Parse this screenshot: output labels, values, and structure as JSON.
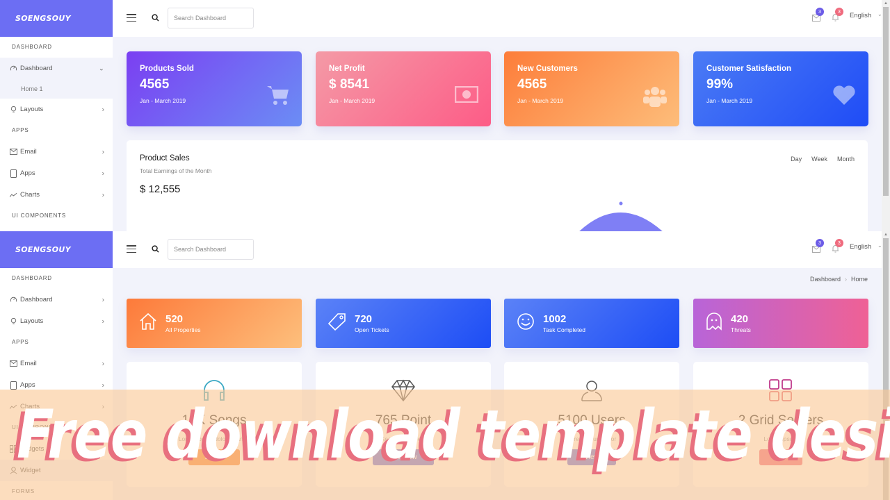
{
  "brand": "SOENGSOUY",
  "header": {
    "search_placeholder": "Search Dashboard",
    "mail_badge": "3",
    "bell_badge": "3",
    "language": "English"
  },
  "colors": {
    "brand": "#6c6ef3",
    "mail_badge": "#6c5ce7",
    "bell_badge": "#ef6b7e"
  },
  "sidebar_top": {
    "sections": [
      "DASHBOARD",
      "APPS",
      "UI COMPONENTS"
    ],
    "items": [
      {
        "label": "Dashboard",
        "icon": "gauge-icon",
        "expanded": true
      },
      {
        "label": "Home 1"
      },
      {
        "label": "Layouts",
        "icon": "bulb-icon"
      },
      {
        "label": "Email",
        "icon": "mail-icon"
      },
      {
        "label": "Apps",
        "icon": "tablet-icon"
      },
      {
        "label": "Charts",
        "icon": "chart-line-icon"
      }
    ]
  },
  "sidebar_bottom": {
    "sections": [
      "DASHBOARD",
      "APPS",
      "UI COMPONENTS",
      "FORMS"
    ],
    "items": [
      {
        "label": "Dashboard",
        "icon": "gauge-icon"
      },
      {
        "label": "Layouts",
        "icon": "bulb-icon"
      },
      {
        "label": "Email",
        "icon": "mail-icon"
      },
      {
        "label": "Apps",
        "icon": "tablet-icon"
      },
      {
        "label": "Charts",
        "icon": "chart-line-icon"
      },
      {
        "label": "Widgets",
        "icon": "grid-icon"
      },
      {
        "label": "Widget",
        "icon": "user-icon"
      }
    ]
  },
  "stats": [
    {
      "title": "Products Sold",
      "value": "4565",
      "period": "Jan - March 2019",
      "icon": "cart-icon"
    },
    {
      "title": "Net Profit",
      "value": "$ 8541",
      "period": "Jan - March 2019",
      "icon": "money-icon"
    },
    {
      "title": "New Customers",
      "value": "4565",
      "period": "Jan - March 2019",
      "icon": "users-icon"
    },
    {
      "title": "Customer Satisfaction",
      "value": "99%",
      "period": "Jan - March 2019",
      "icon": "heart-icon"
    }
  ],
  "sales": {
    "title": "Product Sales",
    "subtitle": "Total Earnings of the Month",
    "amount": "$ 12,555",
    "periods": [
      "Day",
      "Week",
      "Month"
    ]
  },
  "breadcrumb": [
    "Dashboard",
    "Home"
  ],
  "mini_stats": [
    {
      "value": "520",
      "label": "All Properties",
      "icon": "home-icon"
    },
    {
      "value": "720",
      "label": "Open Tickets",
      "icon": "tag-icon"
    },
    {
      "value": "1002",
      "label": "Task Completed",
      "icon": "smile-icon"
    },
    {
      "value": "420",
      "label": "Threats",
      "icon": "ghost-icon"
    }
  ],
  "features": [
    {
      "value": "15K Songs",
      "desc": "Lorem ipsum dolor sit amet",
      "button": "Listen",
      "icon": "headphones-icon"
    },
    {
      "value": "765 Point",
      "desc": "Keep going great",
      "button": "Join now",
      "icon": "diamond-icon"
    },
    {
      "value": "5100 Users",
      "desc": "Lorem ipsum dolor",
      "button": "View",
      "icon": "user-icon"
    },
    {
      "value": "2 Grid Servers",
      "desc": "Lorem ipsum",
      "button": "Go",
      "icon": "grid-icon"
    }
  ],
  "watermark": "Free download template design"
}
